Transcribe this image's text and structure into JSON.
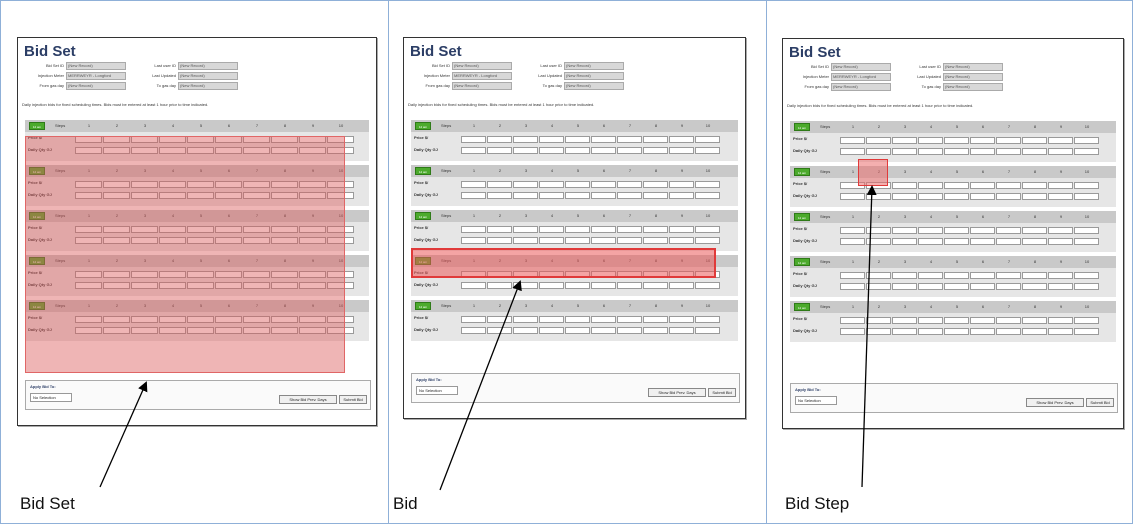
{
  "panels": [
    {
      "id": "panel-1",
      "caption": "Bid Set",
      "screenshot_title": "Bid Set",
      "highlight": "bid-set"
    },
    {
      "id": "panel-2",
      "caption": "Bid",
      "screenshot_title": "Bid Set",
      "highlight": "bid"
    },
    {
      "id": "panel-3",
      "caption": "Bid Step",
      "screenshot_title": "Bid Set",
      "highlight": "bid-step"
    }
  ],
  "form": {
    "bid_set_id_label": "Bid Set ID",
    "bid_set_id_value": "(New Record)",
    "last_user_id_label": "Last user ID",
    "last_user_id_value": "(New Record)",
    "injection_meter_label": "Injection Meter",
    "injection_meter_value": "MERRWEYR - Longford",
    "last_updated_label": "Last Updated",
    "last_updated_value": "(New Record)",
    "from_gas_day_label": "From gas day",
    "from_gas_day_value": "(New Record)",
    "to_gas_day_label": "To gas day",
    "to_gas_day_value": "(New Record)"
  },
  "instructions": "Daily injection bids for fixed scheduling times. Bids must be entered at least 1 hour prior to time indicated.",
  "bid_block": {
    "button_label": "12 am",
    "steps_label": "Steps",
    "step_numbers": [
      "1",
      "2",
      "3",
      "4",
      "5",
      "6",
      "7",
      "8",
      "9",
      "10"
    ],
    "price_label": "Price $/",
    "qty_label": "Daily Qty GJ"
  },
  "apply": {
    "label": "Apply Bid To:",
    "select_value": "No Selection"
  },
  "buttons": {
    "show_bid_prev": "Show Bid Prev. Days",
    "submit_bid": "Submit Bid"
  },
  "colors": {
    "title": "#2c3e66",
    "green_button": "#4caa2c",
    "highlight": "#e03a3a"
  }
}
